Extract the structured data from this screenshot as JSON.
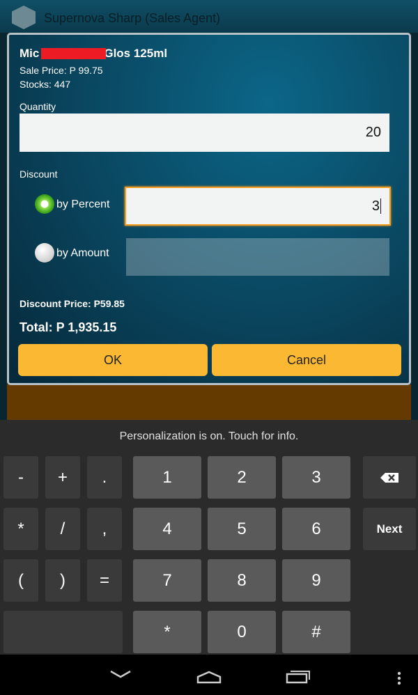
{
  "app": {
    "title": "Supernova Sharp (Sales Agent)"
  },
  "dialog": {
    "product_name_start": "Mic",
    "product_name_end": "Glos 125ml",
    "sale_price": "Sale Price: P 99.75",
    "stocks": "Stocks: 447",
    "quantity_label": "Quantity",
    "quantity_value": "20",
    "discount_label": "Discount",
    "by_percent_label": "by Percent",
    "by_percent_value": "3",
    "by_percent_selected": true,
    "by_amount_label": "by Amount",
    "by_amount_value": "",
    "discount_price": "Discount Price: P59.85",
    "total": "Total: P 1,935.15",
    "ok_label": "OK",
    "cancel_label": "Cancel"
  },
  "keyboard": {
    "hint": "Personalization is on. Touch for info.",
    "left_keys": [
      "-",
      "+",
      ".",
      "*",
      "/",
      ",",
      "(",
      ")",
      "="
    ],
    "num_keys": [
      "1",
      "2",
      "3",
      "4",
      "5",
      "6",
      "7",
      "8",
      "9",
      "*",
      "0",
      "#"
    ],
    "next_label": "Next",
    "backspace_icon": "backspace-icon"
  },
  "navbar": {
    "icons": [
      "back-icon",
      "home-icon",
      "recents-icon",
      "menu-icon"
    ]
  }
}
